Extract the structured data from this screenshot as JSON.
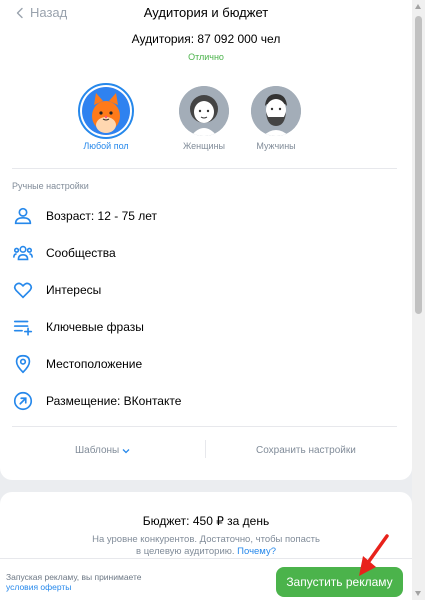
{
  "header": {
    "back_label": "Назад",
    "title": "Аудитория и бюджет"
  },
  "audience": {
    "text": "Аудитория: 87 092 000 чел",
    "status": "Отлично"
  },
  "gender": {
    "options": [
      {
        "label": "Любой пол",
        "selected": true,
        "icon": "cat-avatar-icon"
      },
      {
        "label": "Женщины",
        "selected": false,
        "icon": "woman-avatar-icon"
      },
      {
        "label": "Мужчины",
        "selected": false,
        "icon": "man-avatar-icon"
      }
    ]
  },
  "manual": {
    "header": "Ручные настройки",
    "items": [
      {
        "label": "Возраст: 12 - 75 лет",
        "icon": "user-icon"
      },
      {
        "label": "Сообщества",
        "icon": "users-icon"
      },
      {
        "label": "Интересы",
        "icon": "heart-icon"
      },
      {
        "label": "Ключевые фразы",
        "icon": "text-add-icon"
      },
      {
        "label": "Местоположение",
        "icon": "location-icon"
      },
      {
        "label": "Размещение: ВКонтакте",
        "icon": "arrow-up-right-circle-icon"
      }
    ]
  },
  "footer_links": {
    "templates": "Шаблоны",
    "save": "Сохранить настройки"
  },
  "budget": {
    "text": "Бюджет: 450 ₽ за день",
    "hint_line1": "На уровне конкурентов. Достаточно, чтобы попасть",
    "hint_line2": "в целевую аудиторию.",
    "hint_link": "Почему?"
  },
  "bottom_bar": {
    "terms_text": "Запуская рекламу, вы принимаете",
    "terms_link": "условия оферты",
    "launch_button": "Запустить рекламу"
  },
  "colors": {
    "accent": "#2688eb",
    "success": "#4bb34b",
    "secondary_text": "#818c99",
    "annotation_arrow": "#e8221b"
  }
}
